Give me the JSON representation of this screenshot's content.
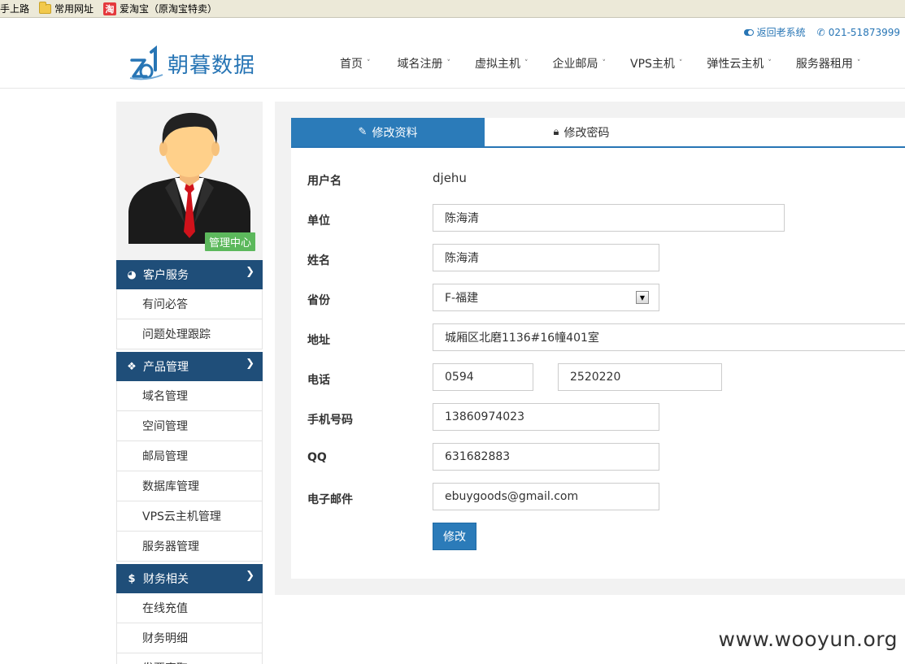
{
  "bookmarks": [
    {
      "label": "手上路",
      "icon": "none"
    },
    {
      "label": "常用网址",
      "icon": "folder-icon"
    },
    {
      "label": "爱淘宝（原淘宝特卖）",
      "icon": "taobao-icon",
      "icon_text": "淘"
    }
  ],
  "header": {
    "return_old": "返回老系统",
    "phone": "021-51873999",
    "logo_text": "朝暮数据"
  },
  "nav": [
    "首页",
    "域名注册",
    "虚拟主机",
    "企业邮局",
    "VPS主机",
    "弹性云主机",
    "服务器租用"
  ],
  "sidebar": {
    "badge": "管理中心",
    "sections": [
      {
        "title": "客户服务",
        "icon": "dashboard-icon",
        "items": [
          "有问必答",
          "问题处理跟踪"
        ]
      },
      {
        "title": "产品管理",
        "icon": "cubes-icon",
        "items": [
          "域名管理",
          "空间管理",
          "邮局管理",
          "数据库管理",
          "VPS云主机管理",
          "服务器管理"
        ]
      },
      {
        "title": "财务相关",
        "icon": "dollar-icon",
        "items": [
          "在线充值",
          "财务明细",
          "发票索取"
        ]
      }
    ]
  },
  "tabs": [
    {
      "label": "修改资料",
      "icon": "edit-icon",
      "active": true
    },
    {
      "label": "修改密码",
      "icon": "lock-icon",
      "active": false
    }
  ],
  "form": {
    "username_label": "用户名",
    "username_value": "djehu",
    "company_label": "单位",
    "company_value": "陈海清",
    "name_label": "姓名",
    "name_value": "陈海清",
    "province_label": "省份",
    "province_value": "F-福建",
    "address_label": "地址",
    "address_value": "城厢区北磨1136#16幢401室",
    "phone_label": "电话",
    "phone_area": "0594",
    "phone_number": "2520220",
    "mobile_label": "手机号码",
    "mobile_value": "13860974023",
    "qq_label": "QQ",
    "qq_value": "631682883",
    "email_label": "电子邮件",
    "email_value": "ebuygoods@gmail.com",
    "submit_label": "修改"
  },
  "watermark": "www.wooyun.org",
  "colors": {
    "primary": "#2b7bb9",
    "sidebar_head": "#1f4e79",
    "badge": "#5cb85c"
  }
}
